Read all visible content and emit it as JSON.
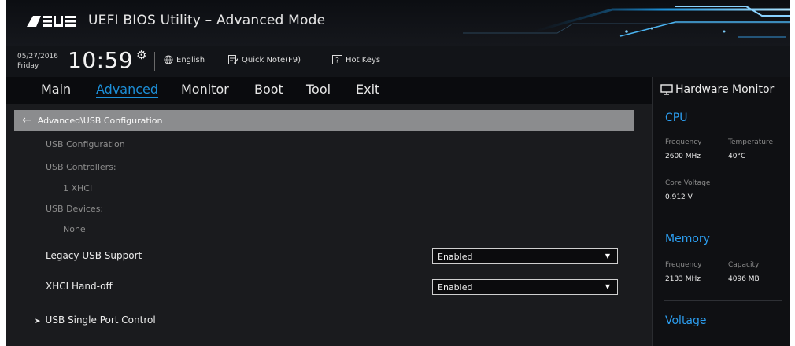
{
  "title_bar": {
    "brand": "ASUS",
    "app_title": "UEFI BIOS Utility – Advanced Mode"
  },
  "info_bar": {
    "date": "05/27/2016",
    "day": "Friday",
    "time": "10:59",
    "language": "English",
    "quick_note": "Quick Note(F9)",
    "hot_keys": "Hot Keys"
  },
  "menu": [
    {
      "label": "Main",
      "active": false
    },
    {
      "label": "Advanced",
      "active": true
    },
    {
      "label": "Monitor",
      "active": false
    },
    {
      "label": "Boot",
      "active": false
    },
    {
      "label": "Tool",
      "active": false
    },
    {
      "label": "Exit",
      "active": false
    }
  ],
  "main": {
    "breadcrumb": "Advanced\\USB Configuration",
    "info_lines": [
      "USB Configuration",
      "USB Controllers:",
      "1 XHCI",
      "USB Devices:",
      "None"
    ],
    "options": [
      {
        "label": "Legacy USB Support",
        "value": "Enabled"
      },
      {
        "label": "XHCI Hand-off",
        "value": "Enabled"
      }
    ],
    "submenu": "USB Single Port Control"
  },
  "hardware_monitor": {
    "title": "Hardware Monitor",
    "cpu": {
      "section": "CPU",
      "frequency_label": "Frequency",
      "frequency_value": "2600 MHz",
      "temperature_label": "Temperature",
      "temperature_value": "40°C",
      "core_voltage_label": "Core Voltage",
      "core_voltage_value": "0.912 V"
    },
    "memory": {
      "section": "Memory",
      "frequency_label": "Frequency",
      "frequency_value": "2133 MHz",
      "capacity_label": "Capacity",
      "capacity_value": "4096 MB"
    },
    "voltage": {
      "section": "Voltage"
    }
  },
  "colors": {
    "accent": "#1d8fd8",
    "section_blue": "#2c9ef0",
    "breadcrumb_bg": "#8b8c8e"
  }
}
